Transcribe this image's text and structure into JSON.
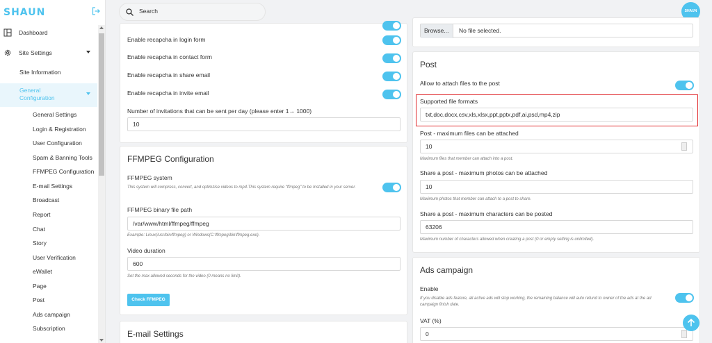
{
  "app": {
    "logo": "SHAUN",
    "avatar_text": "SHAUN"
  },
  "search": {
    "placeholder": "Search"
  },
  "sidebar": {
    "dashboard": "Dashboard",
    "site_settings": "Site Settings",
    "site_information": "Site Information",
    "general_configuration": "General Configuration",
    "sub_items": [
      "General Settings",
      "Login & Registration",
      "User Configuration",
      "Spam & Banning Tools",
      "FFMPEG Configuration",
      "E-mail Settings",
      "Broadcast",
      "Report",
      "Chat",
      "Story",
      "User Verification",
      "eWallet",
      "Page",
      "Post",
      "Ads campaign",
      "Subscription"
    ]
  },
  "left": {
    "recaptcha": [
      "Enable recapcha in login form",
      "Enable recapcha in contact form",
      "Enable recapcha in share email",
      "Enable recapcha in invite email"
    ],
    "invitations_label": "Number of invitations that can be sent per day (please enter 1→ 1000)",
    "invitations_value": "10",
    "ffmpeg_title": "FFMPEG Configuration",
    "ffmpeg_system_label": "FFMPEG system",
    "ffmpeg_system_hint": "This system will compress, convert, and optimzise videos to mp4.This system require \"ffmpeg\" to be Installed in your server.",
    "ffmpeg_path_label": "FFMPEG binary file path",
    "ffmpeg_path_value": "/var/www/html/ffmpeg/ffmpeg",
    "ffmpeg_path_hint": "Example: Linux(/usr/bin/ffmpeg) or Windows(C:\\ffmpeg\\bin\\ffmpeg.exe).",
    "video_duration_label": "Video duration",
    "video_duration_value": "600",
    "video_duration_hint": "Set the max allowed seconds for the video (0 means no limit).",
    "check_button": "Check FFMPEG",
    "email_title": "E-mail Settings"
  },
  "right": {
    "browse_label": "Browse...",
    "file_status": "No file selected.",
    "post_title": "Post",
    "attach_label": "Allow to attach files to the post",
    "formats_label": "Supported file formats",
    "formats_value": "txt,doc,docx,csv,xls,xlsx,ppt,pptx,pdf,ai,psd,mp4,zip",
    "max_files_label": "Post - maximum files can be attached",
    "max_files_value": "10",
    "max_files_hint": "Maximum files that member can attach into a post.",
    "share_photos_label": "Share a post - maximum photos can be attached",
    "share_photos_value": "10",
    "share_photos_hint": "Maximum photos that member can attach to a post to share.",
    "share_chars_label": "Share a post - maximum characters can be posted",
    "share_chars_value": "63206",
    "share_chars_hint": "Maximum number of characters allowed when creating a post (0 or empty setting is unlimited).",
    "ads_title": "Ads campaign",
    "enable_label": "Enable",
    "enable_hint": "If you disable ads feature, all active ads will stop working, the remaining balance will auto refund to owner of the ads at the ad campaign finish date.",
    "vat_label": "VAT (%)",
    "vat_value": "0"
  },
  "colors": {
    "accent": "#4ec3ee",
    "highlight": "#e0292c"
  }
}
